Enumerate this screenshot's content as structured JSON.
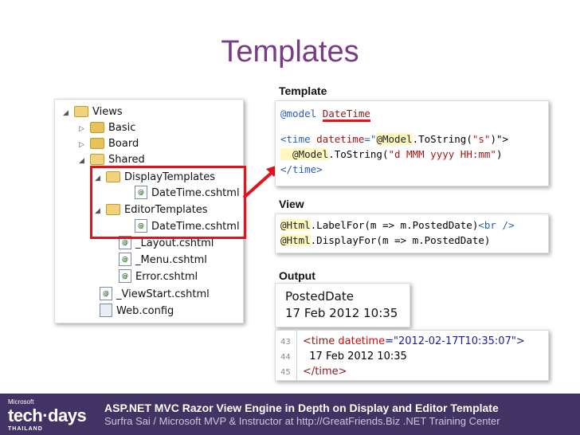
{
  "slide": {
    "title": "Templates"
  },
  "tree": {
    "items": [
      {
        "label": "Views"
      },
      {
        "label": "Basic"
      },
      {
        "label": "Board"
      },
      {
        "label": "Shared"
      },
      {
        "label": "DisplayTemplates"
      },
      {
        "label": "DateTime.cshtml"
      },
      {
        "label": "EditorTemplates"
      },
      {
        "label": "DateTime.cshtml"
      },
      {
        "label": "_Layout.cshtml"
      },
      {
        "label": "_Menu.cshtml"
      },
      {
        "label": "Error.cshtml"
      },
      {
        "label": "_ViewStart.cshtml"
      },
      {
        "label": "Web.config"
      }
    ]
  },
  "sections": {
    "template_label": "Template",
    "view_label": "View",
    "output_label": "Output"
  },
  "template_code": {
    "l1a": "@model ",
    "l1b": "DateTime",
    "l2a": "<time ",
    "l2b": "datetime",
    "l2c": "=\"",
    "l2d": "@Model",
    "l2e": ".ToString(",
    "l2f": "\"s\"",
    "l2g": ")\">",
    "l3a": "  @Model",
    "l3b": ".ToString(",
    "l3c": "\"d MMM yyyy HH:mm\"",
    "l3d": ")",
    "l4": "</time>"
  },
  "view_code": {
    "l1a": "@Html",
    "l1b": ".LabelFor(m => m.PostedDate)",
    "l1c": "<br />",
    "l2a": "@Html",
    "l2b": ".DisplayFor(m => m.PostedDate)"
  },
  "output": {
    "line1": "PostedDate",
    "line2": "17 Feb 2012 10:35"
  },
  "source": {
    "ln1": "43",
    "ln2": "44",
    "ln3": "45",
    "l1a": "<time ",
    "l1b": "datetime",
    "l1c": "=\"2012-02-17T10:35:07\">",
    "l2": "  17 Feb 2012 10:35",
    "l3": "</time>"
  },
  "footer": {
    "brand_small": "Microsoft",
    "brand": "tech·days",
    "country": "THAILAND",
    "title": "ASP.NET MVC Razor  View Engine  in Depth on Display and Editor Template",
    "subtitle": "Surfra Sai / Microsoft MVP & Instructor at http://GreatFriends.Biz .NET Training Center"
  },
  "colors": {
    "title": "#7a3b86",
    "footer_bg": "#413464",
    "highlight": "#e1141e"
  }
}
